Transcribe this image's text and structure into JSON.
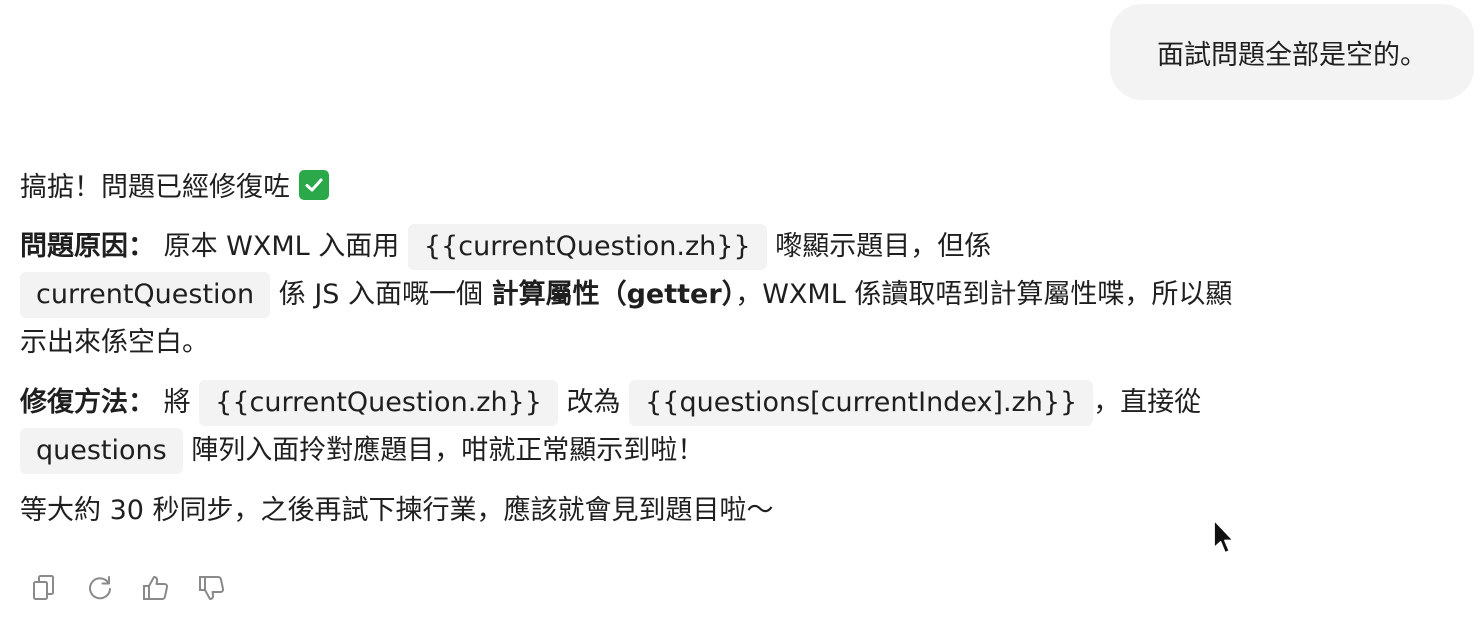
{
  "user_message": "面試問題全部是空的。",
  "reply": {
    "line1": "搞掂！問題已經修復咗",
    "cause": {
      "label": "問題原因：",
      "t1": " 原本 WXML 入面用 ",
      "code1": "{{currentQuestion.zh}}",
      "t2": " 嚟顯示題目，但係",
      "code2": "currentQuestion",
      "t3": " 係 JS 入面嘅一個 ",
      "bold1": "計算屬性（getter）",
      "t4": "，WXML 係讀取唔到計算屬性喋，所以顯示出來係空白。"
    },
    "fix": {
      "label": "修復方法：",
      "t1": " 將 ",
      "code1": "{{currentQuestion.zh}}",
      "t2": " 改為 ",
      "code2": "{{questions[currentIndex].zh}}",
      "t3": "，直接從",
      "code3": "questions",
      "t4": " 陣列入面拎對應題目，咁就正常顯示到啦！"
    },
    "closing": "等大約 30 秒同步，之後再試下揀行業，應該就會見到題目啦～"
  },
  "icons": {
    "check": "check-mark-icon",
    "copy": "copy-icon",
    "regenerate": "regenerate-icon",
    "thumbs_up": "thumbs-up-icon",
    "thumbs_down": "thumbs-down-icon",
    "cursor": "mouse-cursor-icon"
  },
  "colors": {
    "bubble": "#f3f3f3",
    "code_bg": "#f3f3f3",
    "check": "#2aa84a",
    "icon": "#8a8a8a"
  }
}
